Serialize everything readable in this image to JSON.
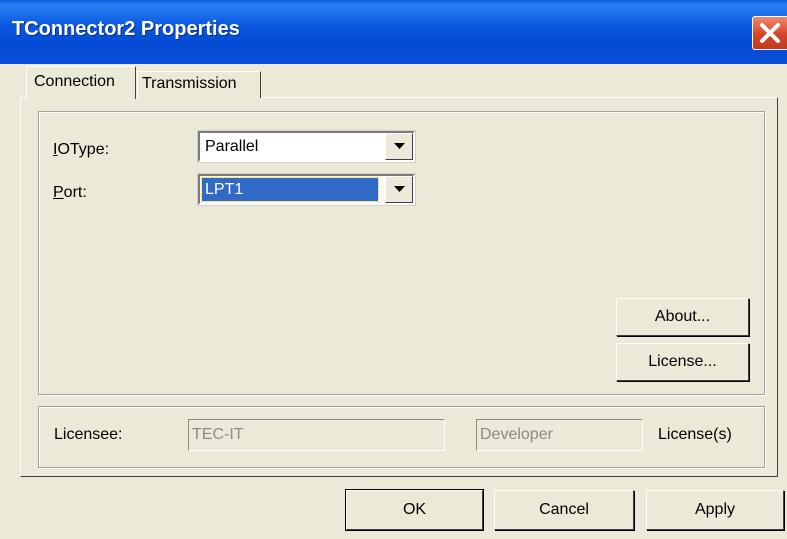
{
  "window": {
    "title": "TConnector2 Properties"
  },
  "tabs": [
    {
      "label": "Connection",
      "selected": true
    },
    {
      "label": "Transmission",
      "selected": false
    }
  ],
  "connection": {
    "iotype_label": "IOType:",
    "iotype_value": "Parallel",
    "port_label": "Port:",
    "port_value": "LPT1",
    "about_button": "About...",
    "license_button": "License..."
  },
  "license_info": {
    "licensee_label": "Licensee:",
    "licensee_value": "TEC-IT",
    "license_type_value": "Developer",
    "licenses_label": "License(s)"
  },
  "buttons": {
    "ok": "OK",
    "cancel": "Cancel",
    "apply": "Apply"
  },
  "icons": {
    "close": "close-icon",
    "dropdown": "chevron-down-icon"
  },
  "colors": {
    "title_bar": "#0a58df",
    "selection": "#316ac5",
    "close_button": "#d5452a",
    "dialog_bg": "#ece9d8"
  }
}
